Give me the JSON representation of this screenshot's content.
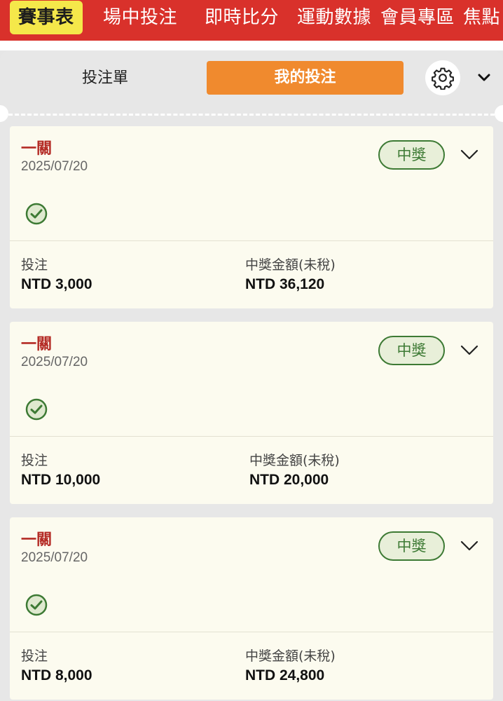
{
  "nav": {
    "items": [
      {
        "label": "賽事表",
        "active": true
      },
      {
        "label": "場中投注",
        "active": false
      },
      {
        "label": "即時比分",
        "active": false
      },
      {
        "label": "運動數據",
        "active": false
      },
      {
        "label": "會員專區",
        "active": false
      },
      {
        "label": "焦點",
        "active": false
      }
    ]
  },
  "tabs": {
    "bet_slip": "投注單",
    "my_bets": "我的投注"
  },
  "icons": {
    "settings": "gear-icon",
    "collapse": "chevron-down-icon",
    "status": "check-circle-icon",
    "expand": "chevron-down-icon"
  },
  "colors": {
    "nav_bg": "#d9312b",
    "nav_active_bg": "#f5e84a",
    "tab_active_bg": "#f08a2e",
    "bet_type": "#b42b25",
    "win_green": "#3d7a34",
    "card_bg": "#fcfbef"
  },
  "bets": [
    {
      "type": "一關",
      "date": "2025/07/20",
      "status": "中獎",
      "stake_label": "投注",
      "stake": "NTD 3,000",
      "payout_label": "中獎金額(未稅)",
      "payout": "NTD 36,120"
    },
    {
      "type": "一關",
      "date": "2025/07/20",
      "status": "中獎",
      "stake_label": "投注",
      "stake": "NTD 10,000",
      "payout_label": "中獎金額(未稅)",
      "payout": "NTD 20,000"
    },
    {
      "type": "一關",
      "date": "2025/07/20",
      "status": "中獎",
      "stake_label": "投注",
      "stake": "NTD 8,000",
      "payout_label": "中獎金額(未稅)",
      "payout": "NTD 24,800"
    }
  ]
}
